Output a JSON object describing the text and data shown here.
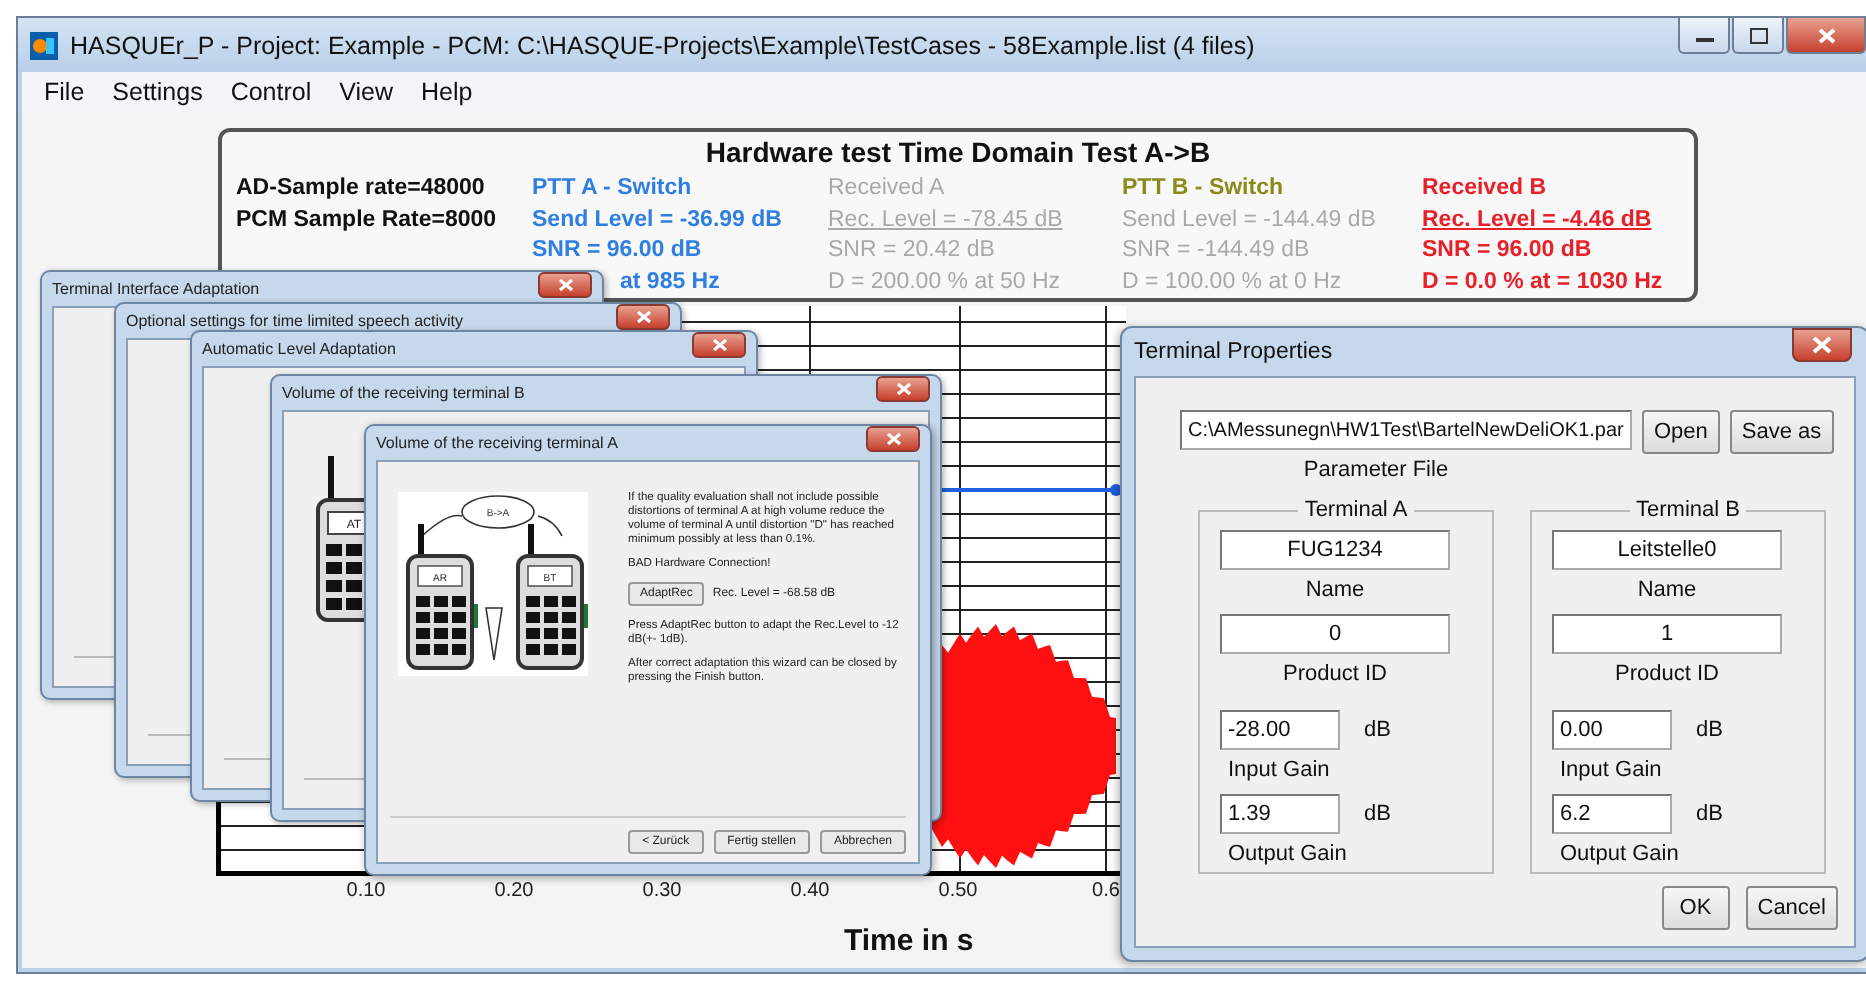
{
  "window": {
    "title": "HASQUEr_P - Project: Example - PCM: C:\\HASQUE-Projects\\Example\\TestCases - 58Example.list (4 files)"
  },
  "menu": [
    "File",
    "Settings",
    "Control",
    "View",
    "Help"
  ],
  "header": {
    "title": "Hardware test Time Domain Test A->B",
    "columns": [
      {
        "lines": [
          {
            "text": "AD-Sample rate=48000",
            "color": "#111111",
            "bold": true,
            "underlined": false
          },
          {
            "text": "PCM Sample Rate=8000",
            "color": "#111111",
            "bold": true,
            "underlined": false
          }
        ]
      },
      {
        "lines": [
          {
            "text": "PTT A - Switch",
            "color": "#2f7fe0",
            "bold": true,
            "underlined": false
          },
          {
            "text": "Send Level = -36.99 dB",
            "color": "#2f7fe0",
            "bold": true,
            "underlined": false
          },
          {
            "text": "SNR = 96.00 dB",
            "color": "#2f7fe0",
            "bold": true,
            "underlined": false
          },
          {
            "text": "at 985 Hz",
            "color": "#2f7fe0",
            "bold": true,
            "underlined": false
          }
        ]
      },
      {
        "lines": [
          {
            "text": "Received A",
            "color": "#a9a9a9",
            "bold": false,
            "underlined": false
          },
          {
            "text": "Rec. Level = -78.45 dB",
            "color": "#a9a9a9",
            "bold": false,
            "underlined": true
          },
          {
            "text": "SNR = 20.42 dB",
            "color": "#a9a9a9",
            "bold": false,
            "underlined": false
          },
          {
            "text": "D = 200.00 % at 50 Hz",
            "color": "#a9a9a9",
            "bold": false,
            "underlined": false
          }
        ]
      },
      {
        "lines": [
          {
            "text": "PTT B - Switch",
            "color": "#8a8a1a",
            "bold": true,
            "underlined": false
          },
          {
            "text": "Send Level = -144.49 dB",
            "color": "#a9a9a9",
            "bold": false,
            "underlined": false
          },
          {
            "text": "SNR = -144.49 dB",
            "color": "#a9a9a9",
            "bold": false,
            "underlined": false
          },
          {
            "text": "D = 100.00 % at 0 Hz",
            "color": "#a9a9a9",
            "bold": false,
            "underlined": false
          }
        ]
      },
      {
        "lines": [
          {
            "text": "Received B",
            "color": "#e8202a",
            "bold": true,
            "underlined": false
          },
          {
            "text": "Rec. Level = -4.46 dB",
            "color": "#e8202a",
            "bold": true,
            "underlined": true
          },
          {
            "text": "SNR = 96.00 dB",
            "color": "#e8202a",
            "bold": true,
            "underlined": false
          },
          {
            "text": "D = 0.0 % at = 1030 Hz",
            "color": "#e8202a",
            "bold": true,
            "underlined": false
          }
        ]
      }
    ]
  },
  "plot": {
    "x_ticks": [
      "0.10",
      "0.20",
      "0.30",
      "0.40",
      "0.50",
      "0.6"
    ],
    "xlabel": "Time in s"
  },
  "background_windows": [
    {
      "title": "Terminal Interface Adaptation"
    },
    {
      "title": "Optional settings for time limited speech activity"
    },
    {
      "title": "Automatic Level Adaptation"
    },
    {
      "title": "Volume of the receiving terminal B",
      "radio_label": "AT"
    }
  ],
  "wizard": {
    "title": "Volume of the receiving terminal A",
    "drawing": {
      "cloud_label": "B->A",
      "radios": [
        {
          "label": "AR"
        },
        {
          "label": "BT"
        }
      ]
    },
    "intro": "If the quality evaluation shall not include possible distortions of terminal A at high volume reduce the volume of terminal A until distortion \"D\" has reached minimum possibly at less than 0.1%.",
    "status": "BAD Hardware Connection!",
    "action_button": "AdaptRec",
    "reading": "Rec. Level = -68.58 dB",
    "hint": "Press AdaptRec button to adapt the Rec.Level to -12 dB(+- 1dB).",
    "finish_note": "After correct adaptation this wizard can be closed by pressing the Finish button.",
    "buttons": [
      "< Zurück",
      "Fertig stellen",
      "Abbrechen"
    ]
  },
  "terminal_properties": {
    "title": "Terminal Properties",
    "path": "C:\\AMessunegn\\HW1Test\\BartelNewDeliOK1.par",
    "path_label": "Parameter File",
    "file_buttons": [
      "Open",
      "Save as"
    ],
    "terminals": [
      {
        "title": "Terminal A",
        "fields": [
          {
            "kind": "wide",
            "value": "FUG1234",
            "label": "Name"
          },
          {
            "kind": "wide",
            "value": "0",
            "label": "Product ID"
          },
          {
            "kind": "gain",
            "value": "-28.00",
            "unit": "dB",
            "label": "Input Gain"
          },
          {
            "kind": "gain",
            "value": "1.39",
            "unit": "dB",
            "label": "Output Gain"
          }
        ]
      },
      {
        "title": "Terminal B",
        "fields": [
          {
            "kind": "wide",
            "value": "Leitstelle0",
            "label": "Name"
          },
          {
            "kind": "wide",
            "value": "1",
            "label": "Product ID"
          },
          {
            "kind": "gain",
            "value": "0.00",
            "unit": "dB",
            "label": "Input Gain"
          },
          {
            "kind": "gain",
            "value": "6.2",
            "unit": "dB",
            "label": "Output Gain"
          }
        ]
      }
    ],
    "buttons": [
      "OK",
      "Cancel"
    ]
  }
}
